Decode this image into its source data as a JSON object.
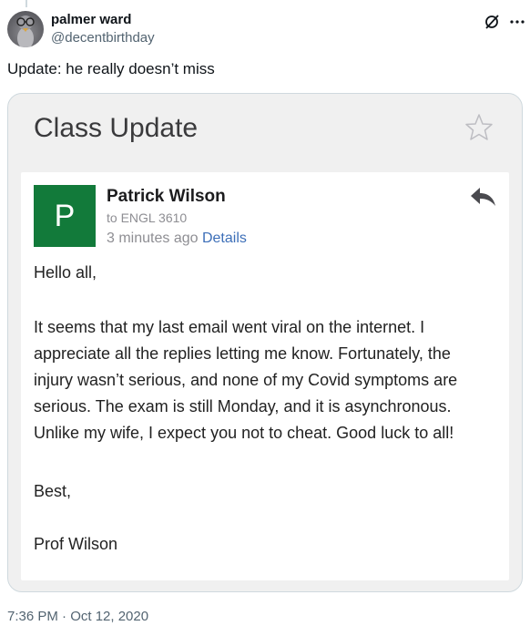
{
  "tweet": {
    "display_name": "palmer ward",
    "handle": "@decentbirthday",
    "text": "Update: he really doesn’t miss",
    "timestamp": "7:36 PM · Oct 12, 2020"
  },
  "email": {
    "subject": "Class Update",
    "sender_initial": "P",
    "sender_name": "Patrick Wilson",
    "to_line": "to ENGL 3610",
    "time_ago": "3 minutes ago",
    "details_label": "Details",
    "body_lines": [
      "Hello all,",
      "It seems that my last email went viral on the internet. I",
      "appreciate all the replies letting me know. Fortunately, the",
      "injury wasn’t serious, and none of my Covid symptoms are",
      "serious. The exam is still Monday, and it is asynchronous.",
      "Unlike my wife, I expect you not to cheat. Good luck to all!",
      "Best,",
      "Prof Wilson"
    ]
  },
  "icons": [
    "grok-icon",
    "more-icon",
    "star-icon",
    "reply-icon"
  ],
  "colors": {
    "sender_avatar": "#127a3a",
    "link": "#3d6fb8",
    "muted": "#536471"
  }
}
